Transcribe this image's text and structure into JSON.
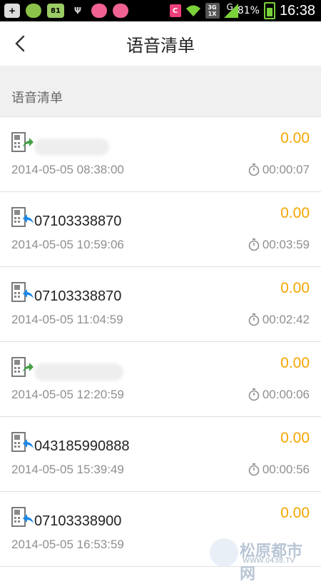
{
  "status_bar": {
    "battery_percent": "81%",
    "time": "16:38",
    "network_label": "G",
    "data_badge": "3G",
    "sim_badge": "1X"
  },
  "header": {
    "title": "语音清单"
  },
  "section": {
    "title": "语音清单"
  },
  "records": [
    {
      "direction": "outgoing",
      "number": "",
      "amount": "0.00",
      "datetime": "2014-05-05 08:38:00",
      "duration": "00:00:07"
    },
    {
      "direction": "incoming",
      "number": "07103338870",
      "amount": "0.00",
      "datetime": "2014-05-05 10:59:06",
      "duration": "00:03:59"
    },
    {
      "direction": "incoming",
      "number": "07103338870",
      "amount": "0.00",
      "datetime": "2014-05-05 11:04:59",
      "duration": "00:02:42"
    },
    {
      "direction": "outgoing",
      "number": "",
      "amount": "0.00",
      "datetime": "2014-05-05 12:20:59",
      "duration": "00:00:06"
    },
    {
      "direction": "incoming",
      "number": "043185990888",
      "amount": "0.00",
      "datetime": "2014-05-05 15:39:49",
      "duration": "00:00:56"
    },
    {
      "direction": "incoming",
      "number": "07103338900",
      "amount": "0.00",
      "datetime": "2014-05-05 16:53:59",
      "duration": ""
    }
  ],
  "watermark": {
    "text": "松原都市网",
    "url": "WWW.0438.TV"
  },
  "colors": {
    "amount": "#f5a500",
    "incoming_arrow": "#1e88e5",
    "outgoing_arrow": "#43a047"
  }
}
